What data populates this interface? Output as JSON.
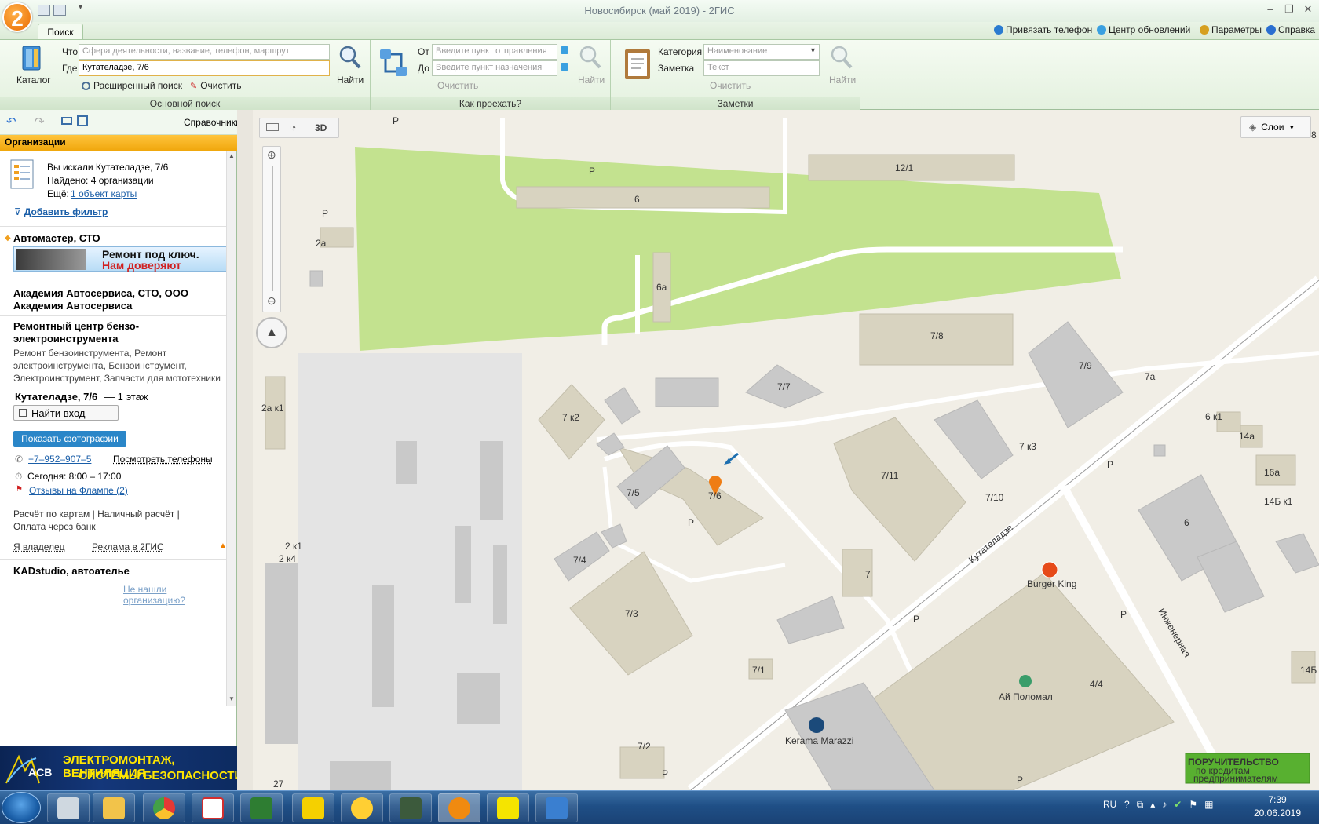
{
  "app": {
    "title": "Новосибирск (май 2019) - 2ГИС",
    "logo_text": "2"
  },
  "ribbon": {
    "tab_search": "Поиск",
    "top_links": [
      "Привязать телефон",
      "Центр обновлений",
      "Параметры",
      "Справка"
    ],
    "main_search": {
      "catalog": "Каталог",
      "what_label": "Что",
      "what_placeholder": "Сфера деятельности, название, телефон, маршрут",
      "where_label": "Где",
      "where_value": "Кутателадзе, 7/6",
      "find": "Найти",
      "advanced": "Расширенный поиск",
      "clear": "Очистить",
      "group_label": "Основной поиск"
    },
    "route": {
      "from_label": "От",
      "from_placeholder": "Введите пункт отправления",
      "to_label": "До",
      "to_placeholder": "Введите пункт назначения",
      "find": "Найти",
      "clear": "Очистить",
      "group_label": "Как проехать?"
    },
    "notes": {
      "category_label": "Категория",
      "category_placeholder": "Наименование",
      "note_label": "Заметка",
      "note_placeholder": "Текст",
      "find": "Найти",
      "clear": "Очистить",
      "group_label": "Заметки"
    }
  },
  "sidebar": {
    "directories": "Справочники",
    "header": "Организации",
    "search_summary": {
      "searched": "Вы искали Кутателадзе, 7/6",
      "found": "Найдено: 4 организации",
      "more_prefix": "Ещё:",
      "more_link": "1 объект карты"
    },
    "add_filter": "Добавить фильтр",
    "org1": {
      "name": "Автомастер, СТО",
      "ad_line1": "Ремонт под ключ.",
      "ad_line2": "Нам доверяют"
    },
    "org2": {
      "name": "Академия Автосервиса, СТО, ООО",
      "subtitle": "Академия Автосервиса"
    },
    "org3": {
      "name_line1": "Ремонтный центр бензо-",
      "name_line2": "электроинструмента",
      "rubrics_line1": "Ремонт бензоинструмента, Ремонт",
      "rubrics_line2": "электроинструмента, Бензоинструмент,",
      "rubrics_line3": "Электроинструмент, Запчасти для мототехники",
      "address": "Кутателадзе, 7/6",
      "floor": "— 1 этаж",
      "find_entrance": "Найти вход",
      "show_photos": "Показать фотографии",
      "phone": "+7‒952‒907‒5",
      "view_phones": "Посмотреть телефоны",
      "hours": "Сегодня: 8:00 – 17:00",
      "reviews": "Отзывы на Флампе (2)",
      "payment_line1": "Расчёт по картам | Наличный расчёт |",
      "payment_line2": "Оплата через банк",
      "owner": "Я владелец",
      "advert": "Реклама в 2ГИС"
    },
    "org4": {
      "name": "KADstudio, автоателье"
    },
    "not_found": "Не нашли организацию?",
    "bottom_ad": {
      "brand": "ACB",
      "line1": "ЭЛЕКТРОМОНТАЖ, ВЕНТИЛЯЦИЯ",
      "line2": "СИСТЕМЫ БЕЗОПАСНОСТИ"
    }
  },
  "map": {
    "mode_3d": "3D",
    "layers": "Слои",
    "streets": [
      "Кутателадзе",
      "Инженерная"
    ],
    "pois": [
      "Burger King",
      "Ай Поломал",
      "Kerama Marazzi"
    ],
    "buildings": [
      "12/1",
      "6",
      "6а",
      "7/8",
      "7/9",
      "7а",
      "7/7",
      "7 к2",
      "7/6",
      "7/5",
      "7/4",
      "7/3",
      "7/11",
      "7/10",
      "7 к3",
      "7",
      "7/1",
      "7/2",
      "4/4",
      "6 к1",
      "14а",
      "16а",
      "14Б к1",
      "6",
      "14Б",
      "2а",
      "2а к1",
      "2 к1",
      "2 к4",
      "27",
      "8"
    ],
    "parking": "P",
    "ad_badge_line1": "ПОРУЧИТЕЛЬСТВО",
    "ad_badge_line2": "по кредитам",
    "ad_badge_line3": "предпринимателям"
  },
  "taskbar": {
    "lang": "RU",
    "time": "7:39",
    "date": "20.06.2019"
  },
  "colors": {
    "ribbon_bg": "#e4f1df",
    "sidebar_header": "#f0a70c",
    "park": "#c3e28f",
    "building": "#d8d3c0",
    "building_grey": "#c9c9c9",
    "accent_link": "#1a5ea8",
    "photo_button": "#2a86c8"
  }
}
